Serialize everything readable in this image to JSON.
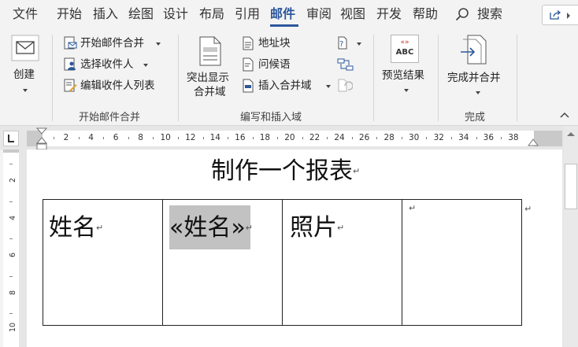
{
  "tabs": [
    "文件",
    "开始",
    "插入",
    "绘图",
    "设计",
    "布局",
    "引用",
    "邮件",
    "审阅",
    "视图",
    "开发",
    "帮助"
  ],
  "active_tab": "邮件",
  "search_label": "搜索",
  "ribbon": {
    "create": {
      "label": "创建",
      "group": ""
    },
    "start_group": {
      "group_label": "开始邮件合并",
      "items": [
        "开始邮件合并",
        "选择收件人",
        "编辑收件人列表"
      ]
    },
    "write_group": {
      "group_label": "编写和插入域",
      "highlight_label_line1": "突出显示",
      "highlight_label_line2": "合并域",
      "items": [
        "地址块",
        "问候语",
        "插入合并域"
      ]
    },
    "preview": {
      "label": "预览结果",
      "icon_text": "ABC",
      "icon_top": "«»"
    },
    "finish": {
      "label": "完成并合并",
      "group_label": "完成"
    }
  },
  "ruler": {
    "numbers": [
      "2",
      "4",
      "6",
      "8",
      "10",
      "12",
      "14",
      "16",
      "18",
      "20",
      "22",
      "24",
      "26",
      "28",
      "30",
      "32",
      "34",
      "36",
      "38"
    ],
    "vertical_numbers": [
      "2",
      "4",
      "6",
      "8",
      "10"
    ]
  },
  "document": {
    "title": "制作一个报表",
    "paragraph_mark": "↵",
    "table": {
      "cells": [
        "姓名",
        "«姓名»",
        "照片",
        ""
      ]
    }
  }
}
